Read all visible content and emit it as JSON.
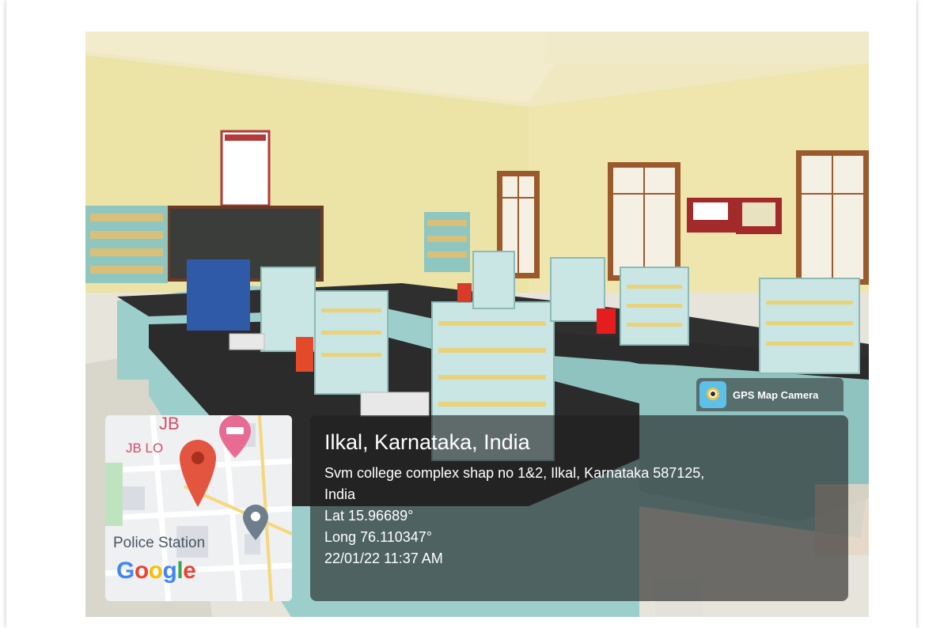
{
  "watermark": {
    "app_name": "GPS Map Camera"
  },
  "location": {
    "title": "Ilkal, Karnataka, India",
    "address_line1": "Svm college complex shap no 1&2, Ilkal, Karnataka 587125,",
    "address_line2": "India",
    "latitude": "Lat 15.96689°",
    "longitude": "Long 76.110347°",
    "timestamp": "22/01/22 11:37 AM"
  },
  "map": {
    "label_top": "JB",
    "label_place": "JB LO",
    "label_police": "Police Station",
    "brand_parts": [
      "G",
      "o",
      "o",
      "g",
      "l",
      "e"
    ]
  },
  "colors": {
    "wall": "#ece3a6",
    "cabinet": "#9ccfcc",
    "countertop": "#2b2b2b",
    "window_frame": "#9a5a2c",
    "pin": "#e4553f"
  }
}
